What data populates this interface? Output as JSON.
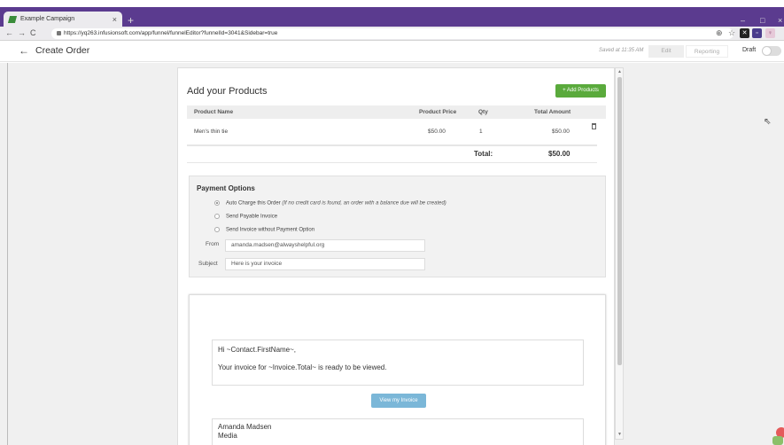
{
  "browser": {
    "tab_title": "Example Campaign",
    "tab_close": "×",
    "new_tab": "+",
    "url": "https://yq263.infusionsoft.com/app/funnel/funnelEditor?funnelId=3041&Sidebar=true",
    "win_min": "–",
    "win_max": "□",
    "win_close": "×"
  },
  "header": {
    "back": "←",
    "title": "Create Order",
    "saved": "Saved at 11:35 AM",
    "edit": "Edit",
    "reporting": "Reporting",
    "draft": "Draft"
  },
  "products": {
    "title": "Add your Products",
    "add_button": "+ Add Products",
    "columns": [
      "Product Name",
      "Product Price",
      "Qty",
      "Total Amount"
    ],
    "rows": [
      {
        "name": "Men's thin tie",
        "price": "$50.00",
        "qty": "1",
        "total": "$50.00"
      }
    ],
    "total_label": "Total:",
    "total_value": "$50.00"
  },
  "payment": {
    "title": "Payment Options",
    "options": [
      {
        "label": "Auto Charge this Order",
        "note": "(If no credit card is found, an order with a balance due will be created)",
        "selected": true
      },
      {
        "label": "Send Payable Invoice",
        "note": "",
        "selected": false
      },
      {
        "label": "Send Invoice without Payment Option",
        "note": "",
        "selected": false
      }
    ],
    "from_label": "From",
    "from_value": "amanda.madsen@alwayshelpful.org",
    "subject_label": "Subject",
    "subject_value": "Here is your invoice"
  },
  "email": {
    "greeting": "Hi ~Contact.FirstName~,",
    "body": "Your invoice for ~Invoice.Total~ is ready to be viewed.",
    "view_button": "View my Invoice",
    "signature_name": "Amanda Madsen",
    "signature_company": "Media"
  },
  "colors": {
    "tabbar": "#5b3b8f",
    "add_button": "#5aaa3c",
    "view_button": "#7bb7d8"
  }
}
